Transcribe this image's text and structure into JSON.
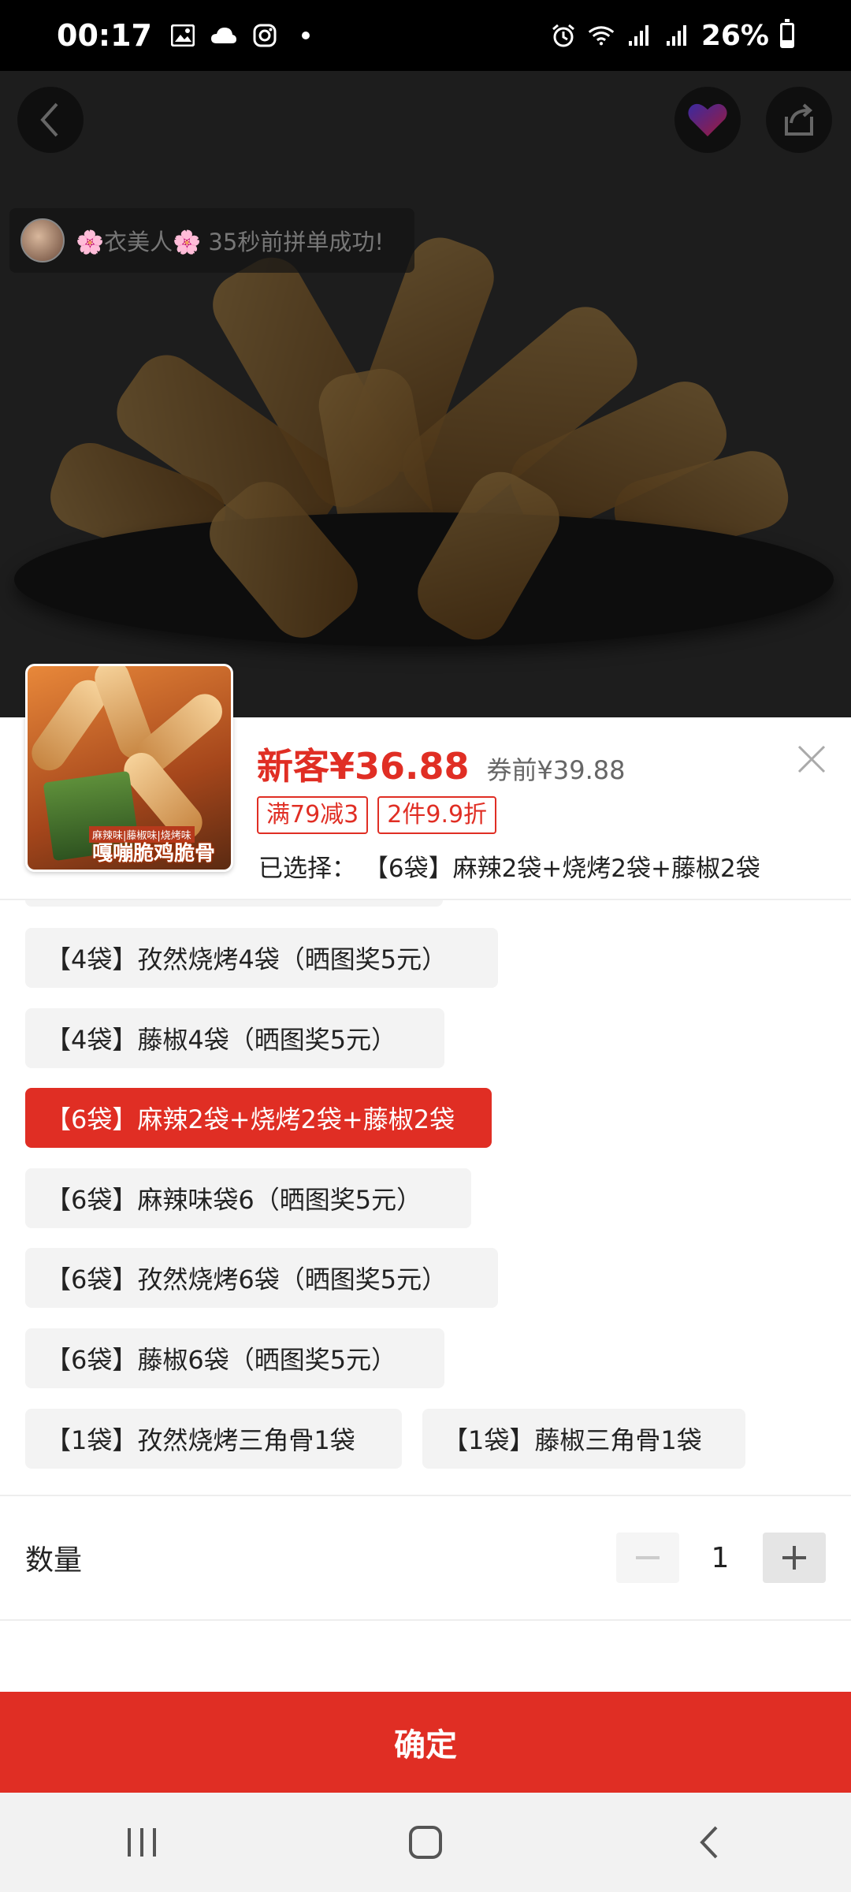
{
  "status_bar": {
    "time": "00:17",
    "left_icons": [
      "gallery-icon",
      "cloud-icon",
      "instagram-icon",
      "dot-icon"
    ],
    "right_icons": [
      "alarm-icon",
      "wifi-icon",
      "signal-icon",
      "signal-icon",
      "battery-icon"
    ],
    "battery_level": 26,
    "battery_text": "26%"
  },
  "hero": {
    "toast_text": "🌸衣美人🌸 35秒前拼单成功!"
  },
  "product": {
    "thumbnail_caption_top": "麻辣味|藤椒味|烧烤味",
    "thumbnail_caption": "嘎嘣脆鸡脆骨",
    "price": "新客¥36.88",
    "original_price": "券前¥39.88",
    "tags": [
      "满79减3",
      "2件9.9折"
    ],
    "selected_label": "已选择：",
    "selected_value": "【6袋】麻辣2袋+烧烤2袋+藤椒2袋"
  },
  "options": [
    "【4袋】孜然烧烤4袋（晒图奖5元）",
    "【4袋】藤椒4袋（晒图奖5元）",
    "【6袋】麻辣2袋+烧烤2袋+藤椒2袋",
    "【6袋】麻辣味袋6（晒图奖5元）",
    "【6袋】孜然烧烤6袋（晒图奖5元）",
    "【6袋】藤椒6袋（晒图奖5元）",
    "【1袋】孜然烧烤三角骨1袋",
    "【1袋】藤椒三角骨1袋"
  ],
  "selected_option_index": 2,
  "quantity": {
    "label": "数量",
    "value": "1"
  },
  "confirm_label": "确定",
  "colors": {
    "accent": "#e02e24",
    "chip_bg": "#f3f3f3"
  }
}
